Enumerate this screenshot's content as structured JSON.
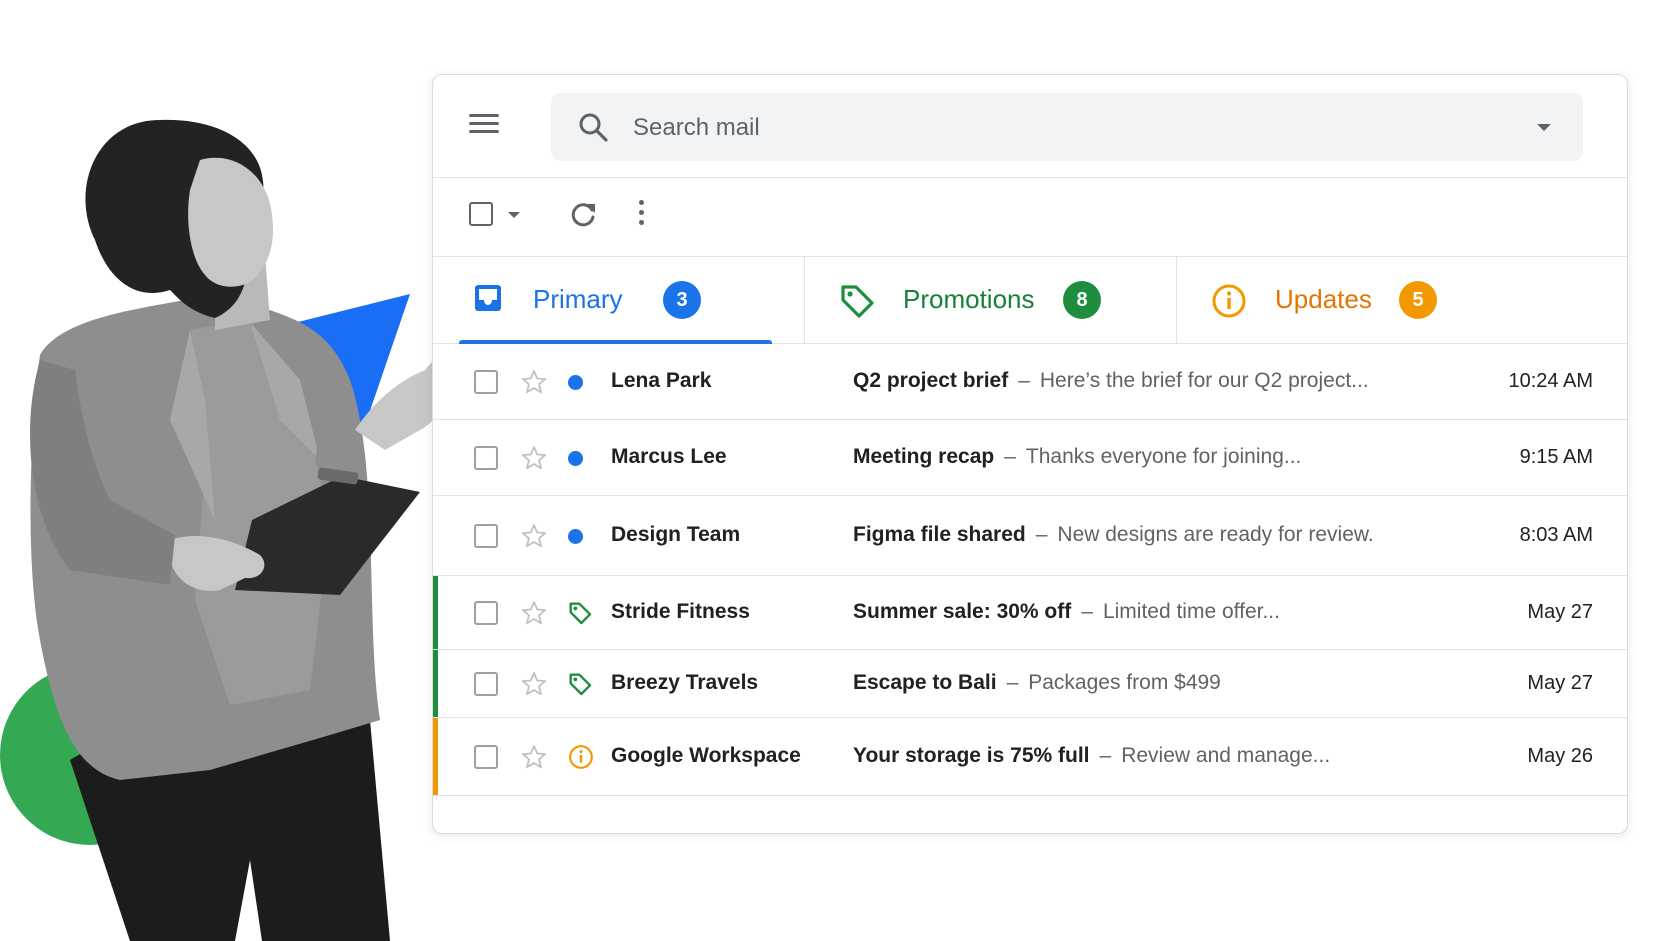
{
  "search": {
    "placeholder": "Search mail"
  },
  "tabs": [
    {
      "label": "Primary",
      "count": "3",
      "color": "#1a73e8",
      "icon": "inbox-icon"
    },
    {
      "label": "Promotions",
      "count": "8",
      "color": "#188038",
      "icon": "tag-icon"
    },
    {
      "label": "Updates",
      "count": "5",
      "color": "#e37400",
      "icon": "info-icon"
    }
  ],
  "emails": [
    {
      "sender": "Lena Park",
      "subject": "Q2 project brief",
      "snippet": "Here’s the brief for our Q2 project...",
      "time": "10:24 AM",
      "category": "unread",
      "bar_color": ""
    },
    {
      "sender": "Marcus Lee",
      "subject": "Meeting recap",
      "snippet": "Thanks everyone for joining...",
      "time": "9:15 AM",
      "category": "unread",
      "bar_color": ""
    },
    {
      "sender": "Design Team",
      "subject": "Figma file shared",
      "snippet": "New designs are ready for review.",
      "time": "8:03 AM",
      "category": "unread",
      "bar_color": ""
    },
    {
      "sender": "Stride Fitness",
      "subject": "Summer sale: 30% off",
      "snippet": "Limited time offer...",
      "time": "May 27",
      "category": "promotion",
      "bar_color": "#1e8e3e"
    },
    {
      "sender": "Breezy Travels",
      "subject": "Escape to Bali",
      "snippet": "Packages from $499",
      "time": "May 27",
      "category": "promotion",
      "bar_color": "#1e8e3e"
    },
    {
      "sender": "Google Workspace",
      "subject": "Your storage is 75% full",
      "snippet": "Review and manage...",
      "time": "May 26",
      "category": "update",
      "bar_color": "#f29900"
    }
  ],
  "separator": "–",
  "colors": {
    "accent_blue": "#1a73e8",
    "promo_green": "#1e8e3e",
    "update_orange": "#f29900",
    "deco_blue": "#1a6ef5",
    "deco_green": "#34a853"
  }
}
